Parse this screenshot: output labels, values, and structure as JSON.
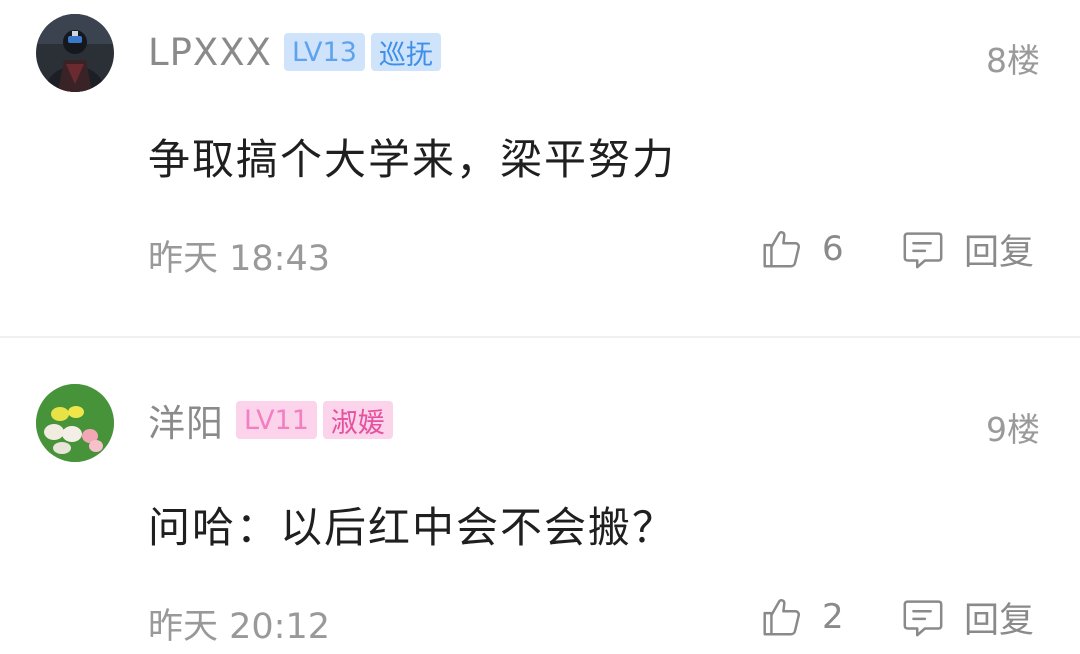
{
  "comments": [
    {
      "username": "LPXXX",
      "level": "LV13",
      "title": "巡抚",
      "floor": "8楼",
      "content": "争取搞个大学来，梁平努力",
      "time": "昨天 18:43",
      "likes": "6",
      "reply_label": "回复"
    },
    {
      "username": "洋阳",
      "level": "LV11",
      "title": "淑媛",
      "floor": "9楼",
      "content": "问哈：以后红中会不会搬？",
      "time": "昨天 20:12",
      "likes": "2",
      "reply_label": "回复"
    }
  ],
  "colors": {
    "username": "#8a8a8a",
    "badge_blue_bg": "#cfe4fb",
    "badge_blue_text": "#3f8fe8",
    "badge_pink_bg": "#fbd3ea",
    "badge_pink_text": "#e5519f",
    "meta": "#999999",
    "content": "#1f1f1f"
  },
  "icons": {
    "like": "thumbs-up-icon",
    "reply": "comment-bubble-icon"
  }
}
